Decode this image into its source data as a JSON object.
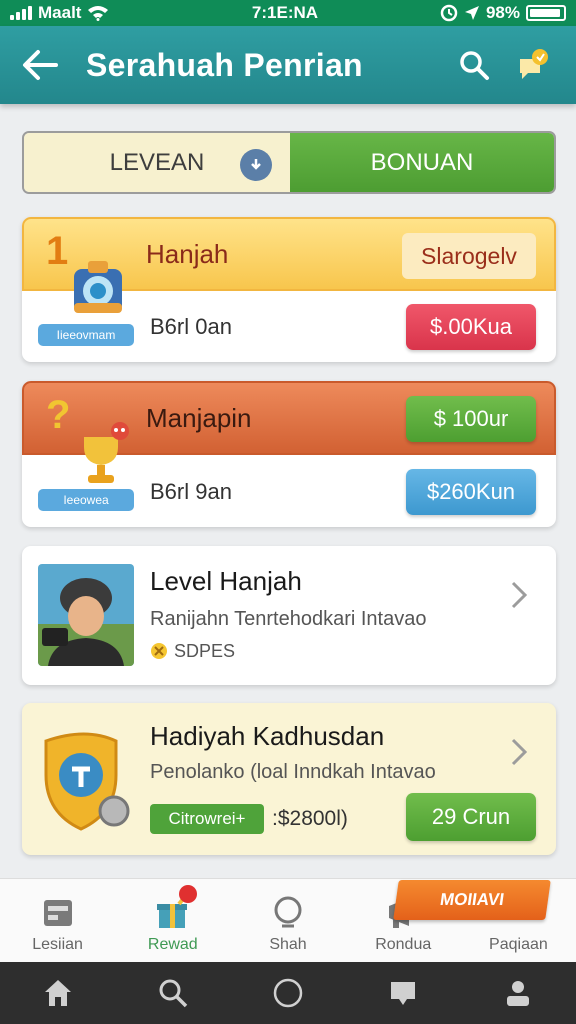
{
  "status_bar": {
    "carrier": "Maalt",
    "time": "7:1E:NA",
    "battery": "98%"
  },
  "app_bar": {
    "title": "Serahuah Penrian",
    "icons": [
      "back-arrow-icon",
      "search-icon",
      "notification-bell-icon"
    ]
  },
  "segment": {
    "left_label": "LEVEAN",
    "right_label": "BONUAN",
    "selected": "right"
  },
  "reward_cards": [
    {
      "rank": "1",
      "title": "Hanjah",
      "head_badge": "Slarogelv",
      "pill": "Iieeovmam",
      "amount": "B6rl 0an",
      "button": "$.00Kua",
      "colors": {
        "head": "#f8c64d",
        "button": "#d9344b"
      }
    },
    {
      "rank": "?",
      "title": "Manjapin",
      "head_badge": "$ 100ur",
      "pill": "Ieeowea",
      "amount": "B6rl 9an",
      "button": "$260Kun",
      "colors": {
        "head": "#d26133",
        "button": "#3d98cf"
      }
    }
  ],
  "list_items": [
    {
      "title": "Level Hanjah",
      "subtitle": "Ranijahn Tenrtehodkari Intavao",
      "meta": "SDPES"
    },
    {
      "title": "Hadiyah Kadhusdan",
      "subtitle": "Penolanko (loal Inndkah Intavao",
      "tag": "Citrowrei+",
      "value": ":$2800l)",
      "button": "29 Crun"
    }
  ],
  "tabs": [
    {
      "label": "Lesiian",
      "icon": "wallet-icon",
      "active": false
    },
    {
      "label": "Rewad",
      "icon": "gift-icon",
      "active": true
    },
    {
      "label": "Shah",
      "icon": "search-circle-icon",
      "active": false
    },
    {
      "label": "Rondua",
      "icon": "megaphone-icon",
      "active": false
    },
    {
      "label": "Paqiaan",
      "icon": "cart-icon",
      "active": false
    }
  ],
  "promo": "MOIIAVI",
  "system_nav": [
    "home-icon",
    "search-icon",
    "circle-icon",
    "chat-icon",
    "person-icon"
  ]
}
